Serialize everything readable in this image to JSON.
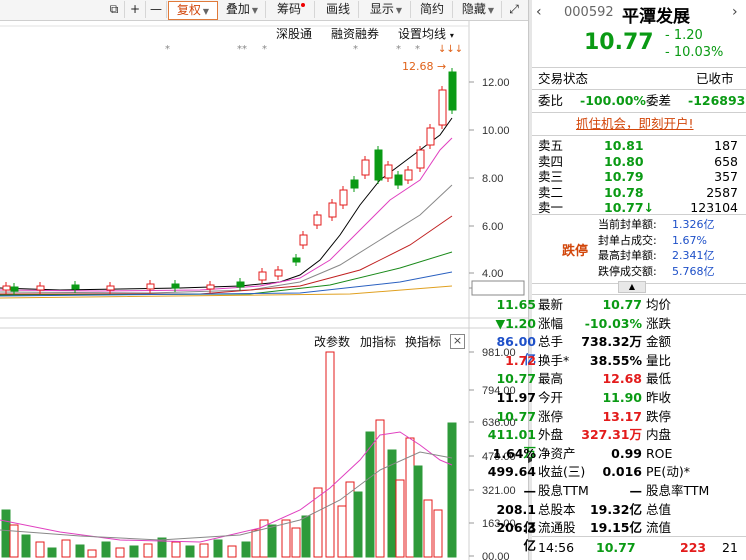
{
  "toolbar": {
    "items": [
      {
        "label": "⧉",
        "name": "toolbar-window-icon"
      },
      {
        "label": "+",
        "name": "toolbar-zoom-in"
      },
      {
        "label": "—",
        "name": "toolbar-zoom-out"
      },
      {
        "label": "复权",
        "name": "toolbar-fuquan",
        "dropdown": true,
        "selected": true
      },
      {
        "label": "叠加",
        "name": "toolbar-diejia",
        "dropdown": true
      },
      {
        "label": "筹码",
        "name": "toolbar-chouma",
        "dot": true
      },
      {
        "label": "画线",
        "name": "toolbar-huaxian"
      },
      {
        "label": "显示",
        "name": "toolbar-xianshi",
        "dropdown": true
      },
      {
        "label": "简约",
        "name": "toolbar-jianyue"
      },
      {
        "label": "隐藏",
        "name": "toolbar-yincang",
        "dropdown": true
      },
      {
        "label": "⤢",
        "name": "toolbar-fullscreen"
      }
    ]
  },
  "kline": {
    "links": {
      "shengutong": "深股通",
      "rongzi": "融资融券",
      "ma_setting": "设置均线"
    },
    "high_label": "12.68",
    "price_axis": [
      "12.00",
      "10.00",
      "8.00",
      "6.00",
      "4.00",
      "3.02"
    ],
    "current_axis_tag": "3.02"
  },
  "volume": {
    "links": {
      "params": "改参数",
      "add_indicator": "加指标",
      "switch_indicator": "换指标"
    },
    "close": "×",
    "axis": [
      "981.00",
      "794.00",
      "636.00",
      "479.00",
      "321.00",
      "163.00",
      "00.00"
    ]
  },
  "colors": {
    "up": "#e31b1b",
    "down": "#0a9a14",
    "text_blue": "#1e50c8"
  },
  "quote": {
    "code": "000592",
    "name": "平潭发展",
    "price": "10.77",
    "change": "- 1.20",
    "change_pct": "- 10.03%",
    "status_label": "交易状态",
    "status_value": "已收市",
    "weibi_label": "委比",
    "weibi_value": "-100.00%",
    "weicha_label": "委差",
    "weicha_value": "-126893",
    "promo": "抓住机会，即刻开户!",
    "asks": [
      {
        "label": "卖五",
        "price": "10.81",
        "vol": "187"
      },
      {
        "label": "卖四",
        "price": "10.80",
        "vol": "658"
      },
      {
        "label": "卖三",
        "price": "10.79",
        "vol": "357"
      },
      {
        "label": "卖二",
        "price": "10.78",
        "vol": "2587"
      },
      {
        "label": "卖一",
        "price": "10.77",
        "vol": "123104",
        "arrow": "↓"
      }
    ],
    "limit_tag": "跌停",
    "limit_stats": [
      {
        "label": "当前封单额:",
        "value": "1.326亿"
      },
      {
        "label": "封单占成交:",
        "value": "1.67%"
      },
      {
        "label": "最高封单额:",
        "value": "2.341亿"
      },
      {
        "label": "跌停成交额:",
        "value": "5.768亿"
      }
    ],
    "stats": [
      [
        {
          "l": "最新",
          "v": "10.77",
          "c": "green"
        },
        {
          "l": "均价",
          "v": "11.65",
          "c": "green"
        }
      ],
      [
        {
          "l": "涨幅",
          "v": "-10.03%",
          "c": "green"
        },
        {
          "l": "涨跌",
          "v": "▼1.20",
          "c": "green"
        }
      ],
      [
        {
          "l": "总手",
          "v": "738.32万",
          "c": "black"
        },
        {
          "l": "金额",
          "v": "86.00亿",
          "c": "blue"
        }
      ],
      [
        {
          "l": "换手*",
          "v": "38.55%",
          "c": "black"
        },
        {
          "l": "量比",
          "v": "1.72",
          "c": "red"
        }
      ],
      [
        {
          "l": "最高",
          "v": "12.68",
          "c": "red"
        },
        {
          "l": "最低",
          "v": "10.77",
          "c": "green"
        }
      ],
      [
        {
          "l": "今开",
          "v": "11.90",
          "c": "green"
        },
        {
          "l": "昨收",
          "v": "11.97",
          "c": "black"
        }
      ],
      [
        {
          "l": "涨停",
          "v": "13.17",
          "c": "red"
        },
        {
          "l": "跌停",
          "v": "10.77",
          "c": "green"
        }
      ],
      [
        {
          "l": "外盘",
          "v": "327.31万",
          "c": "red"
        },
        {
          "l": "内盘",
          "v": "411.01万",
          "c": "green"
        }
      ],
      [
        {
          "l": "净资产",
          "v": "0.99",
          "c": "black"
        },
        {
          "l": "ROE",
          "v": "1.64%",
          "c": "black"
        }
      ],
      [
        {
          "l": "收益(三)",
          "v": "0.016",
          "c": "black"
        },
        {
          "l": "PE(动)*",
          "v": "499.64",
          "c": "black"
        }
      ],
      [
        {
          "l": "股息TTM",
          "v": "—",
          "c": "black"
        },
        {
          "l": "股息率TTM",
          "v": "—",
          "c": "black"
        }
      ],
      [
        {
          "l": "总股本",
          "v": "19.32亿",
          "c": "black"
        },
        {
          "l": "总值",
          "v": "208.1亿",
          "c": "black"
        }
      ],
      [
        {
          "l": "流通股",
          "v": "19.15亿",
          "c": "black"
        },
        {
          "l": "流值",
          "v": "206.3亿",
          "c": "black"
        }
      ]
    ],
    "tick": {
      "time": "14:56",
      "price": "10.77",
      "vol": "223",
      "count": "21"
    }
  }
}
